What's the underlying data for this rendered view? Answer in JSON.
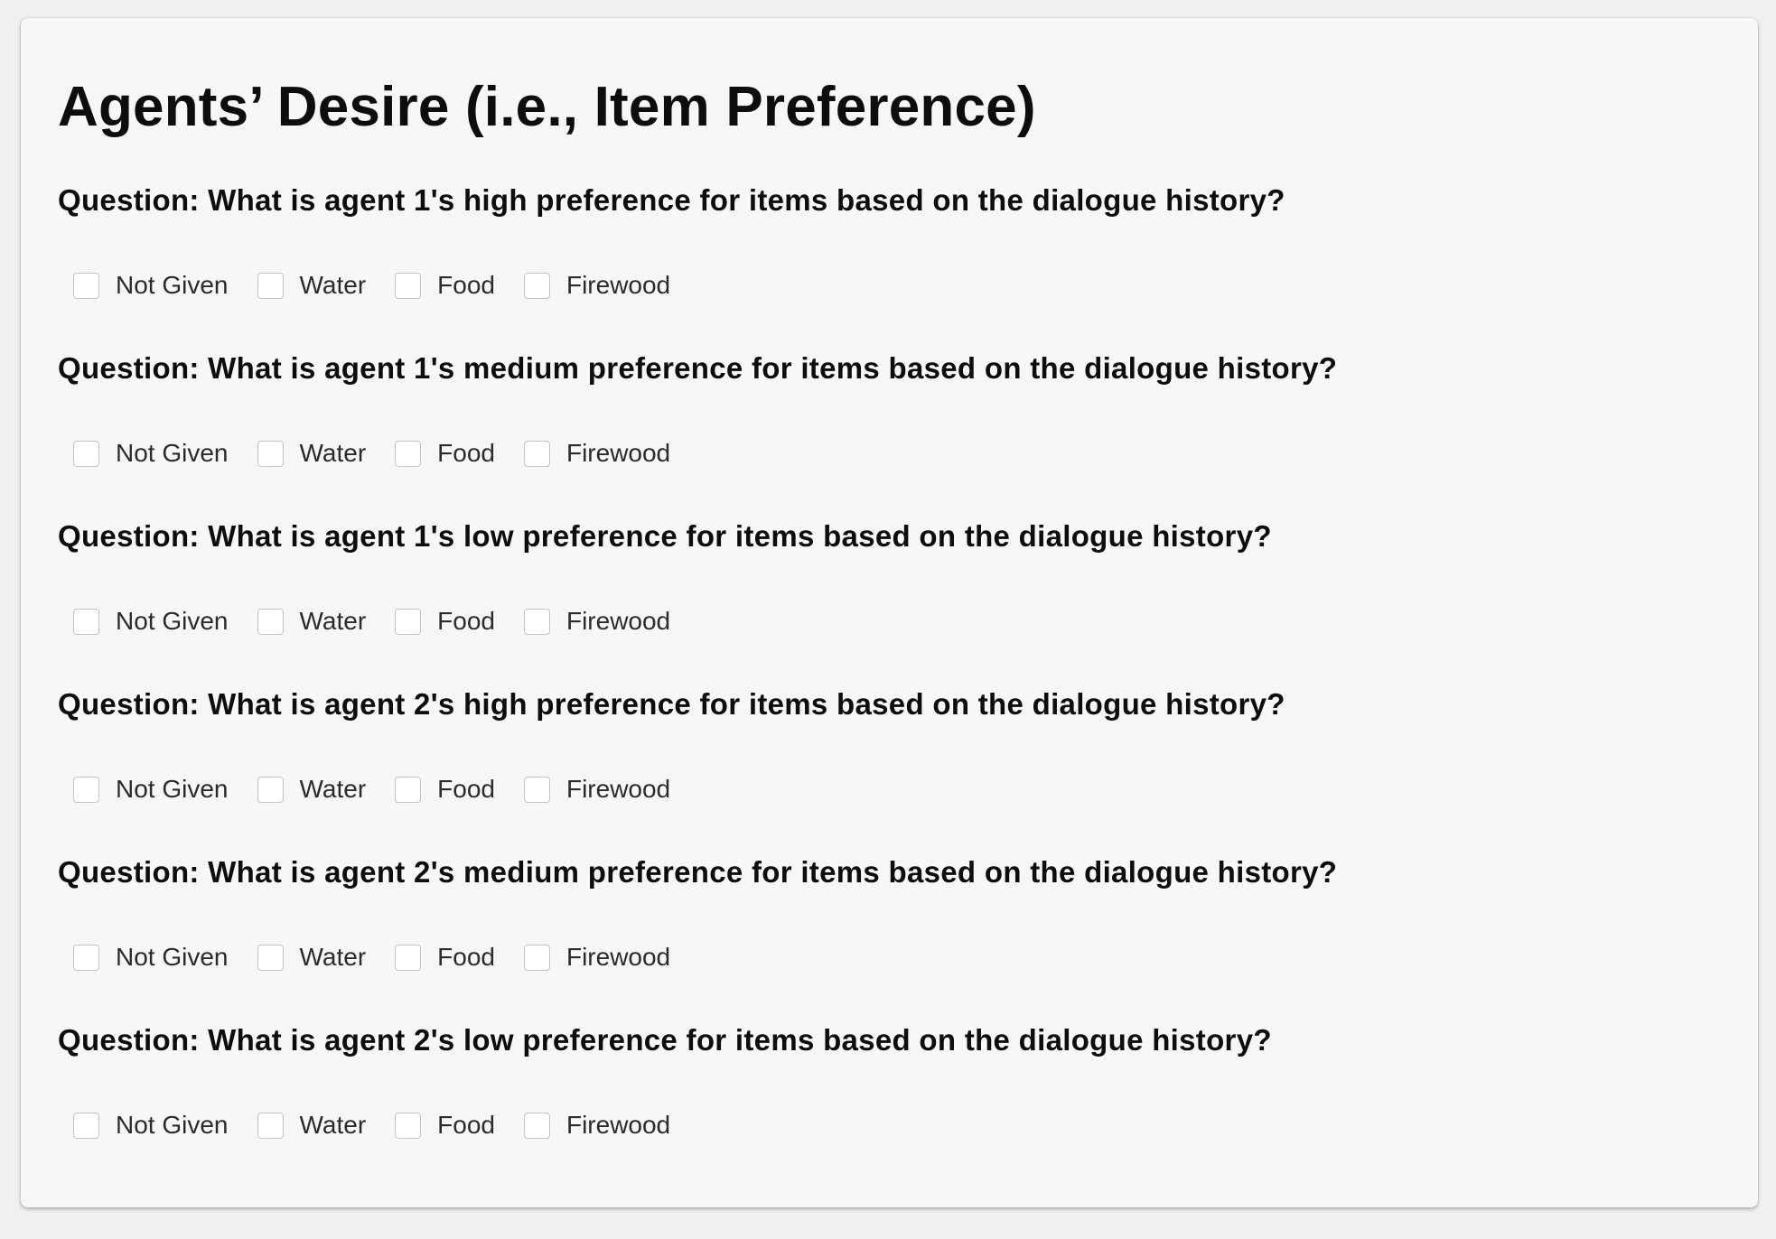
{
  "form": {
    "title": "Agents’ Desire (i.e., Item Preference)",
    "questions": [
      {
        "text": "Question: What is agent 1's high preference for items based on the dialogue history?",
        "options": [
          "Not Given",
          "Water",
          "Food",
          "Firewood"
        ]
      },
      {
        "text": "Question: What is agent 1's medium preference for items based on the dialogue history?",
        "options": [
          "Not Given",
          "Water",
          "Food",
          "Firewood"
        ]
      },
      {
        "text": "Question: What is agent 1's low preference for items based on the dialogue history?",
        "options": [
          "Not Given",
          "Water",
          "Food",
          "Firewood"
        ]
      },
      {
        "text": "Question: What is agent 2's high preference for items based on the dialogue history?",
        "options": [
          "Not Given",
          "Water",
          "Food",
          "Firewood"
        ]
      },
      {
        "text": "Question: What is agent 2's medium preference for items based on the dialogue history?",
        "options": [
          "Not Given",
          "Water",
          "Food",
          "Firewood"
        ]
      },
      {
        "text": "Question: What is agent 2's low preference for items based on the dialogue history?",
        "options": [
          "Not Given",
          "Water",
          "Food",
          "Firewood"
        ]
      }
    ]
  }
}
